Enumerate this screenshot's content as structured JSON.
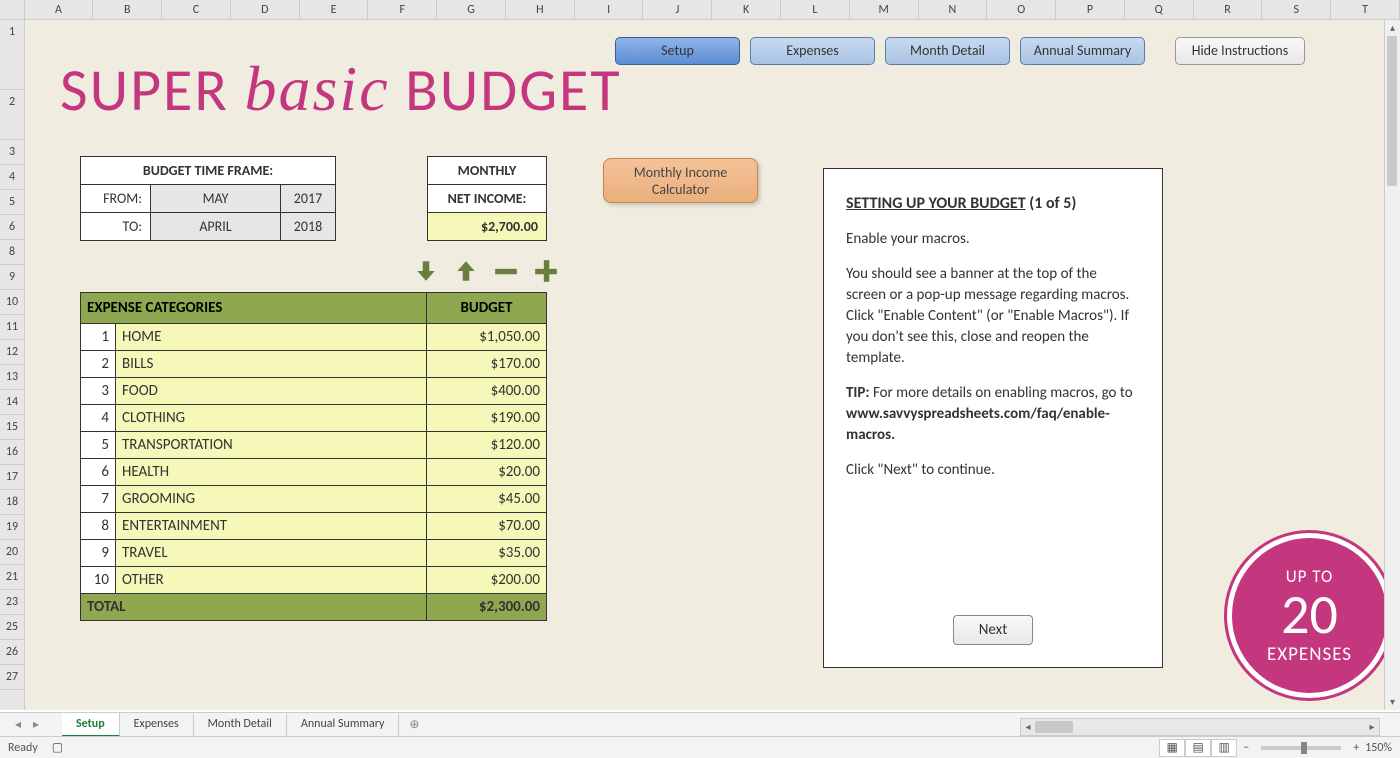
{
  "columns": [
    "A",
    "B",
    "C",
    "D",
    "E",
    "F",
    "G",
    "H",
    "I",
    "J",
    "K",
    "L",
    "M",
    "N",
    "O",
    "P",
    "Q",
    "R",
    "S",
    "T"
  ],
  "rows": [
    "1",
    "2",
    "3",
    "4",
    "5",
    "6",
    "8",
    "9",
    "10",
    "11",
    "12",
    "13",
    "14",
    "15",
    "16",
    "17",
    "18",
    "19",
    "20",
    "21",
    "23",
    "25",
    "26",
    "27"
  ],
  "title": {
    "super": "SUPER ",
    "basic": "basic",
    "budget": " BUDGET"
  },
  "nav": {
    "setup": "Setup",
    "expenses": "Expenses",
    "month_detail": "Month Detail",
    "annual_summary": "Annual Summary",
    "hide_instructions": "Hide Instructions"
  },
  "timeframe": {
    "header": "BUDGET TIME FRAME:",
    "from_label": "FROM:",
    "to_label": "TO:",
    "from_month": "MAY",
    "from_year": "2017",
    "to_month": "APRIL",
    "to_year": "2018"
  },
  "netincome": {
    "monthly": "MONTHLY",
    "label": "NET INCOME:",
    "value": "$2,700.00"
  },
  "calc_btn": {
    "line1": "Monthly Income",
    "line2": "Calculator"
  },
  "expense": {
    "header_cat": "EXPENSE CATEGORIES",
    "header_budget": "BUDGET",
    "rows": [
      {
        "n": "1",
        "name": "HOME",
        "amt": "$1,050.00"
      },
      {
        "n": "2",
        "name": "BILLS",
        "amt": "$170.00"
      },
      {
        "n": "3",
        "name": "FOOD",
        "amt": "$400.00"
      },
      {
        "n": "4",
        "name": "CLOTHING",
        "amt": "$190.00"
      },
      {
        "n": "5",
        "name": "TRANSPORTATION",
        "amt": "$120.00"
      },
      {
        "n": "6",
        "name": "HEALTH",
        "amt": "$20.00"
      },
      {
        "n": "7",
        "name": "GROOMING",
        "amt": "$45.00"
      },
      {
        "n": "8",
        "name": "ENTERTAINMENT",
        "amt": "$70.00"
      },
      {
        "n": "9",
        "name": "TRAVEL",
        "amt": "$35.00"
      },
      {
        "n": "10",
        "name": "OTHER",
        "amt": "$200.00"
      }
    ],
    "total_label": "TOTAL",
    "total_amt": "$2,300.00"
  },
  "instructions": {
    "heading_u": "SETTING UP YOUR BUDGET",
    "heading_rest": " (1 of 5)",
    "p1": "Enable your macros.",
    "p2": "You should see a banner at the top of the screen or a pop-up message regarding macros. Click \"Enable Content\" (or \"Enable Macros\").  If you don't see this, close and reopen the template.",
    "tip_label": "TIP:",
    "tip_text": "  For more details on enabling macros, go to ",
    "tip_link": "www.savvyspreadsheets.com/faq/enable-macros.",
    "p4": "Click \"Next\" to continue.",
    "next": "Next"
  },
  "badge": {
    "up": "UP TO",
    "n": "20",
    "exp": "EXPENSES"
  },
  "sheet_tabs": {
    "setup": "Setup",
    "expenses": "Expenses",
    "month_detail": "Month Detail",
    "annual_summary": "Annual Summary"
  },
  "status": {
    "ready": "Ready",
    "zoom": "150%"
  }
}
